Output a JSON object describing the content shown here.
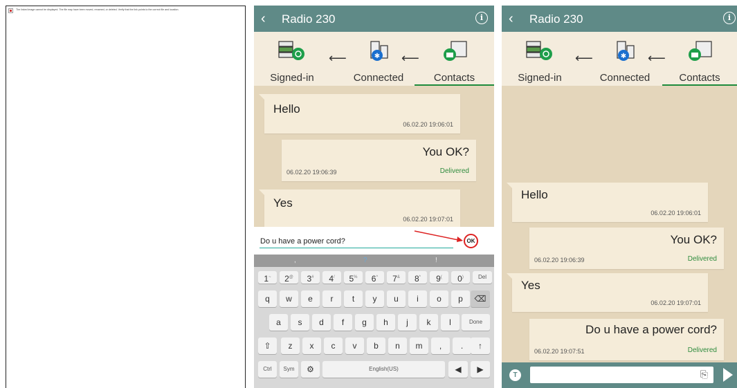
{
  "broken_image": {
    "text": "The linked image cannot be displayed.  The file may have been moved, renamed, or deleted. Verify that the link points to the correct file and location."
  },
  "header": {
    "title": "Radio 230",
    "back_icon": "chevron-left-icon",
    "info_icon": "info-icon",
    "bg_color": "#5f8a87"
  },
  "steps": [
    {
      "label": "Signed-in",
      "icon": "server-stack-icon"
    },
    {
      "label": "Connected",
      "icon": "radio-bluetooth-icon"
    },
    {
      "label": "Contacts",
      "icon": "contact-card-icon",
      "active": true
    }
  ],
  "chat_p1": {
    "messages": [
      {
        "text": "Hello",
        "time": "06.02.20 19:06:01",
        "direction": "incoming"
      },
      {
        "text": "You OK?",
        "time": "06.02.20 19:06:39",
        "status": "Delivered",
        "direction": "outgoing"
      },
      {
        "text": "Yes",
        "time": "06.02.20 19:07:01",
        "direction": "incoming"
      }
    ],
    "input_value": "Do u have a power cord?",
    "ok_label": "OK"
  },
  "keyboard": {
    "suggestions": [
      ",",
      "?",
      "!"
    ],
    "row1": [
      {
        "k": "1",
        "s": "~"
      },
      {
        "k": "2",
        "s": "@"
      },
      {
        "k": "3",
        "s": "#"
      },
      {
        "k": "4",
        "s": "/"
      },
      {
        "k": "5",
        "s": "%"
      },
      {
        "k": "6",
        "s": "^"
      },
      {
        "k": "7",
        "s": "&"
      },
      {
        "k": "8",
        "s": "*"
      },
      {
        "k": "9",
        "s": "("
      },
      {
        "k": "0",
        "s": ")"
      },
      {
        "k": "Del",
        "s": ""
      }
    ],
    "row2": [
      "q",
      "w",
      "e",
      "r",
      "t",
      "y",
      "u",
      "i",
      "o",
      "p"
    ],
    "row3": [
      "a",
      "s",
      "d",
      "f",
      "g",
      "h",
      "j",
      "k",
      "l"
    ],
    "row3_done": "Done",
    "row4": [
      "z",
      "x",
      "c",
      "v",
      "b",
      "n",
      "m",
      ",",
      "."
    ],
    "ctrl": "Ctrl",
    "sym": "Sym",
    "space": "English(US)"
  },
  "chat_p2": {
    "messages": [
      {
        "text": "Hello",
        "time": "06.02.20 19:06:01",
        "direction": "incoming"
      },
      {
        "text": "You OK?",
        "time": "06.02.20 19:06:39",
        "status": "Delivered",
        "direction": "outgoing"
      },
      {
        "text": "Yes",
        "time": "06.02.20 19:07:01",
        "direction": "incoming"
      },
      {
        "text": "Do u have a power cord?",
        "time": "06.02.20 19:07:51",
        "status": "Delivered",
        "direction": "outgoing"
      }
    ],
    "t_button": "T"
  }
}
